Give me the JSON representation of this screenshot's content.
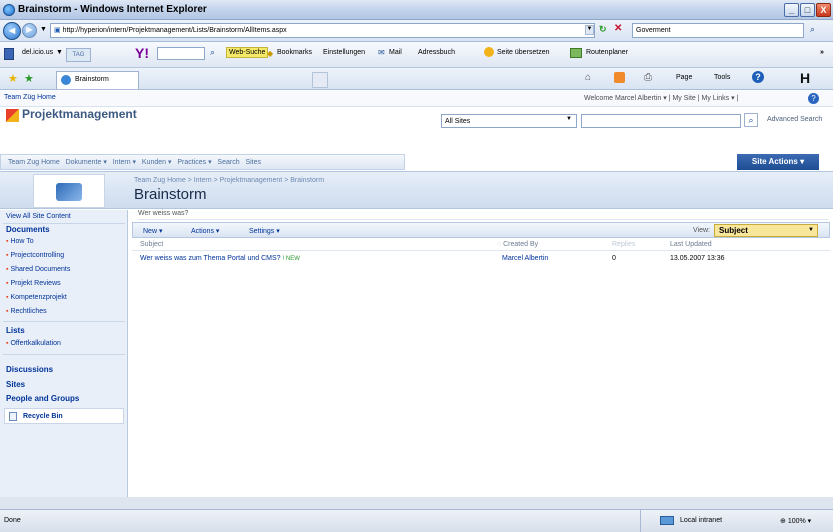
{
  "window": {
    "title": "Brainstorm - Windows Internet Explorer",
    "minimize": "_",
    "maximize": "□",
    "close": "X"
  },
  "address": {
    "url": "http://hyperion/intern/Projektmanagement/Lists/Brainstorm/AllItems.aspx",
    "search_value": "Goverment"
  },
  "toolbar": {
    "delicious": "del.icio.us",
    "tag": "TAG",
    "yahoo": "Y!",
    "web_search": "Web-Suche",
    "bookmarks": "Bookmarks",
    "einstellungen": "Einstellungen",
    "mail": "Mail",
    "adressbuch": "Adressbuch",
    "seite_uebersetzen": "Seite übersetzen",
    "routenplaner": "Routenplaner",
    "more": "»"
  },
  "tabs": {
    "active_tab": "Brainstorm",
    "page_menu": "Page",
    "tools_menu": "Tools"
  },
  "sharepoint": {
    "site_name": "Team Züg Home",
    "welcome": "Welcome Marcel Albertin",
    "my_site": "My Site",
    "my_links": "My Links",
    "header_title": "Projektmanagement",
    "scope": "All Sites",
    "advanced_search": "Advanced Search",
    "site_actions": "Site Actions",
    "nav": [
      "Team Zug Home",
      "Dokumente",
      "Intern",
      "Kunden",
      "Practices",
      "Search",
      "Sites"
    ],
    "breadcrumb": "Team Zug Home > Intern > Projektmanagement > Brainstorm",
    "page_title": "Brainstorm"
  },
  "leftnav": {
    "view_all": "View All Site Content",
    "documents_heading": "Documents",
    "documents": [
      "How To",
      "Projectcontrolling",
      "Shared Documents",
      "Projekt Reviews",
      "Kompetenzprojekt",
      "Rechtliches"
    ],
    "lists_heading": "Lists",
    "lists": [
      "Offertkalkulation"
    ],
    "discussions": "Discussions",
    "sites": "Sites",
    "people": "People and Groups",
    "recycle": "Recycle Bin"
  },
  "list": {
    "description": "Wer weiss was?",
    "new": "New",
    "actions": "Actions",
    "settings": "Settings",
    "view_label": "View:",
    "view_value": "Subject",
    "columns": [
      "Subject",
      "Created By",
      "Replies",
      "Last Updated"
    ],
    "rows": [
      {
        "subject": "Wer weiss was zum Thema Portal und CMS?",
        "new_badge": "! NEW",
        "created_by": "Marcel Albertin",
        "replies": "0",
        "last_updated": "13.05.2007 13:36"
      }
    ]
  },
  "status": {
    "left": "Done",
    "zone": "Local intranet",
    "zoom": "100%"
  }
}
